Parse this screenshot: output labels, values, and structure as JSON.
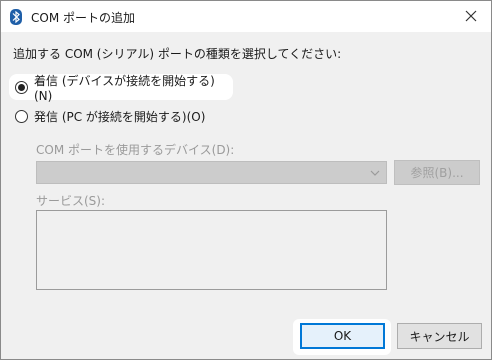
{
  "window": {
    "title": "COM ポートの追加",
    "icon": "bluetooth-icon",
    "close_icon": "close-icon"
  },
  "instruction": "追加する COM (シリアル) ポートの種類を選択してください:",
  "options": [
    {
      "label": "着信 (デバイスが接続を開始する)(N)",
      "checked": true
    },
    {
      "label": "発信 (PC が接続を開始する)(O)",
      "checked": false
    }
  ],
  "device": {
    "label": "COM ポートを使用するデバイス(D):",
    "value": "",
    "browse_label": "参照(B)..."
  },
  "service": {
    "label": "サービス(S):"
  },
  "buttons": {
    "ok": "OK",
    "cancel": "キャンセル"
  },
  "colors": {
    "accent": "#0078d7",
    "window_bg": "#f0f0f0",
    "disabled_text": "#9a9a9a"
  }
}
